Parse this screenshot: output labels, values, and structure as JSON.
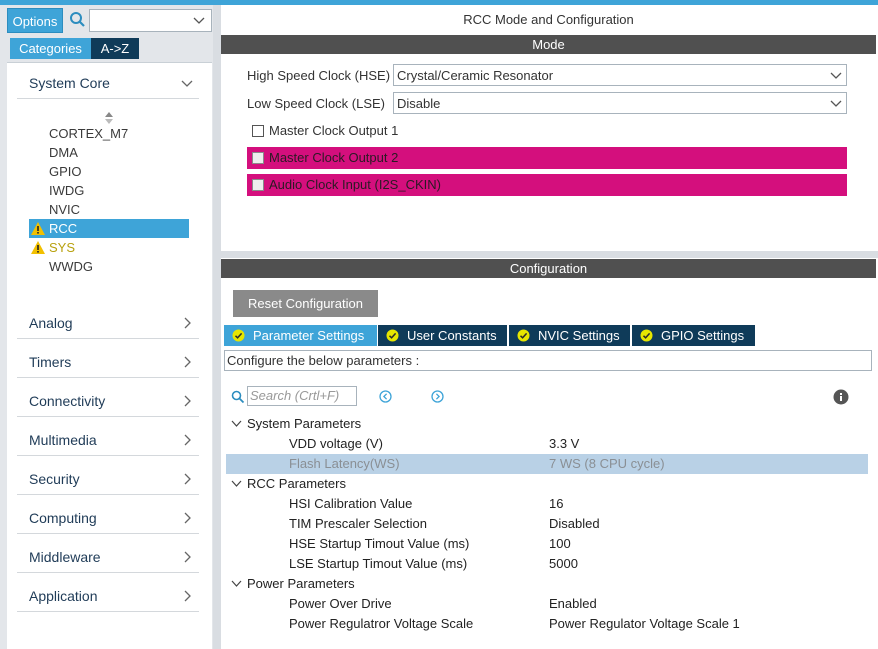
{
  "left": {
    "options_label": "Options",
    "tabs": [
      "Categories",
      "A->Z"
    ],
    "categories_expanded": {
      "label": "System Core"
    },
    "system_core_items": [
      {
        "label": "CORTEX_M7",
        "state": "normal"
      },
      {
        "label": "DMA",
        "state": "normal"
      },
      {
        "label": "GPIO",
        "state": "normal"
      },
      {
        "label": "IWDG",
        "state": "normal"
      },
      {
        "label": "NVIC",
        "state": "normal"
      },
      {
        "label": "RCC",
        "state": "selected-warning"
      },
      {
        "label": "SYS",
        "state": "warning"
      },
      {
        "label": "WWDG",
        "state": "normal"
      }
    ],
    "categories": [
      "Analog",
      "Timers",
      "Connectivity",
      "Multimedia",
      "Security",
      "Computing",
      "Middleware",
      "Application"
    ]
  },
  "right": {
    "title": "RCC Mode and Configuration",
    "mode_bar": "Mode",
    "hse": {
      "label": "High Speed Clock (HSE)",
      "value": "Crystal/Ceramic Resonator"
    },
    "lse": {
      "label": "Low Speed Clock (LSE)",
      "value": "Disable"
    },
    "checkboxes": [
      {
        "label": "Master Clock Output 1",
        "disabled": false
      },
      {
        "label": "Master Clock Output 2",
        "disabled": true
      },
      {
        "label": "Audio Clock Input (I2S_CKIN)",
        "disabled": true
      }
    ],
    "config_bar": "Configuration",
    "reset_label": "Reset Configuration",
    "param_tabs": [
      "Parameter Settings",
      "User Constants",
      "NVIC Settings",
      "GPIO Settings"
    ],
    "configure_text": "Configure the below parameters :",
    "search_placeholder": "Search (Crtl+F)",
    "groups": [
      {
        "label": "System Parameters",
        "rows": [
          {
            "key": "VDD voltage (V)",
            "value": "3.3 V"
          },
          {
            "key": "Flash Latency(WS)",
            "value": "7 WS (8 CPU cycle)"
          }
        ]
      },
      {
        "label": "RCC Parameters",
        "rows": [
          {
            "key": "HSI Calibration Value",
            "value": "16"
          },
          {
            "key": "TIM Prescaler Selection",
            "value": "Disabled"
          },
          {
            "key": "HSE Startup Timout Value (ms)",
            "value": "100"
          },
          {
            "key": "LSE Startup Timout Value (ms)",
            "value": "5000"
          }
        ]
      },
      {
        "label": "Power Parameters",
        "rows": [
          {
            "key": "Power Over Drive",
            "value": "Enabled"
          },
          {
            "key": "Power Regulatror Voltage Scale",
            "value": "Power Regulator Voltage Scale 1"
          }
        ]
      }
    ]
  },
  "colors": {
    "accent": "#3ea4d8",
    "dark_tab": "#0f3b59",
    "disabled_pin": "#d40f7d",
    "warning": "#f2c000",
    "section_bar": "#505050"
  }
}
